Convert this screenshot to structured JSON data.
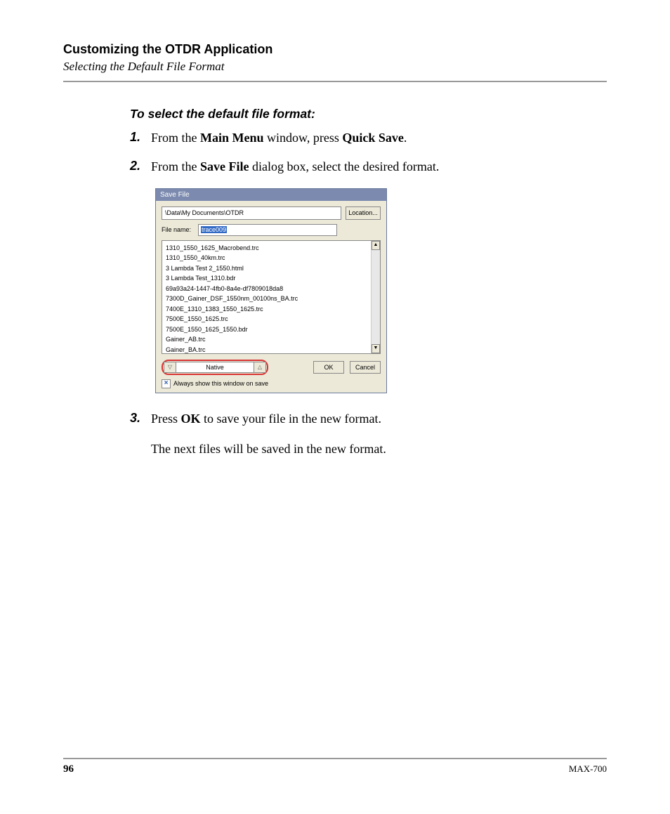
{
  "header": {
    "chapter": "Customizing the OTDR Application",
    "section": "Selecting the Default File Format"
  },
  "instruction_title": "To select the default file format:",
  "steps": {
    "s1_num": "1.",
    "s1_pre": "From the ",
    "s1_b1": "Main Menu",
    "s1_mid": " window, press ",
    "s1_b2": "Quick Save",
    "s1_post": ".",
    "s2_num": "2.",
    "s2_pre": "From the ",
    "s2_b1": "Save File",
    "s2_post": " dialog box, select the desired format.",
    "s3_num": "3.",
    "s3_pre": "Press ",
    "s3_b1": "OK",
    "s3_post": " to save your file in the new format.",
    "s3_follow": "The next files will be saved in the new format."
  },
  "dialog": {
    "title": "Save File",
    "path": "\\Data\\My Documents\\OTDR",
    "location_btn": "Location...",
    "filename_label": "File name:",
    "filename_value": "trace009",
    "files": {
      "f0": "1310_1550_1625_Macrobend.trc",
      "f1": "1310_1550_40km.trc",
      "f2": "3 Lambda Test 2_1550.html",
      "f3": "3 Lambda Test_1310.bdr",
      "f4": "69a93a24-1447-4fb0-8a4e-df7809018da8",
      "f5": "7300D_Gainer_DSF_1550nm_00100ns_BA.trc",
      "f6": "7400E_1310_1383_1550_1625.trc",
      "f7": "7500E_1550_1625.trc",
      "f8": "7500E_1550_1625_1550.bdr",
      "f9": "Gainer_AB.trc",
      "f10": "Gainer_BA.trc"
    },
    "format": "Native",
    "ok": "OK",
    "cancel": "Cancel",
    "always_show": "Always show this window on save"
  },
  "footer": {
    "page": "96",
    "model": "MAX-700"
  }
}
